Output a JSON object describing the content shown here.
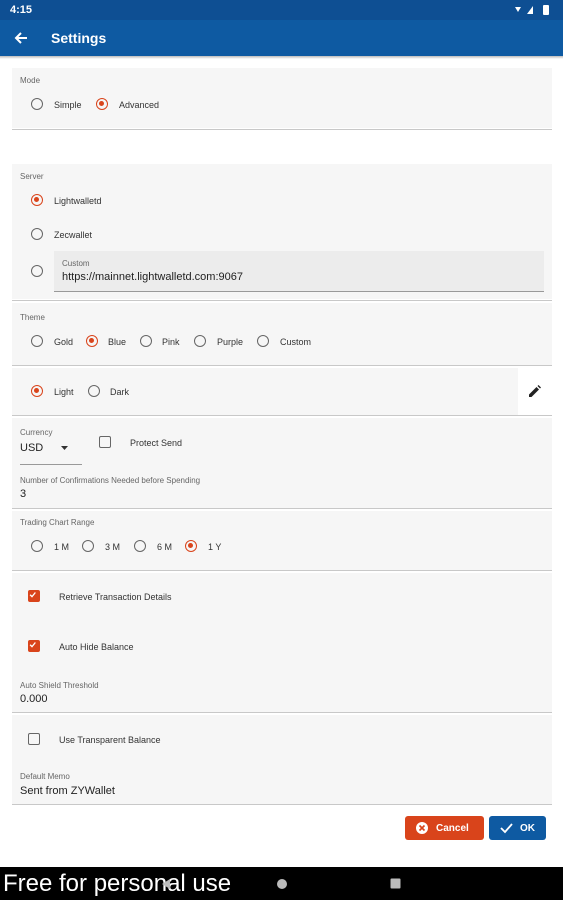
{
  "status_bar": {
    "time": "4:15"
  },
  "app_bar": {
    "title": "Settings"
  },
  "mode": {
    "label": "Mode",
    "options": [
      "Simple",
      "Advanced"
    ],
    "selected": "Advanced"
  },
  "server": {
    "label": "Server",
    "options": [
      "Lightwalletd",
      "Zecwallet"
    ],
    "selected": "Lightwalletd",
    "custom_label": "Custom",
    "custom_value": "https://mainnet.lightwalletd.com:9067"
  },
  "theme": {
    "label": "Theme",
    "options": [
      "Gold",
      "Blue",
      "Pink",
      "Purple",
      "Custom"
    ],
    "selected": "Blue",
    "brightness_options": [
      "Light",
      "Dark"
    ],
    "brightness_selected": "Light"
  },
  "currency": {
    "label": "Currency",
    "value": "USD",
    "protect_send_label": "Protect Send",
    "protect_send_checked": false
  },
  "confirmations": {
    "label": "Number of Confirmations Needed before Spending",
    "value": "3"
  },
  "chart_range": {
    "label": "Trading Chart Range",
    "options": [
      "1 M",
      "3 M",
      "6 M",
      "1 Y"
    ],
    "selected": "1 Y"
  },
  "retrieve_tx": {
    "label": "Retrieve Transaction Details",
    "checked": true
  },
  "auto_hide": {
    "label": "Auto Hide Balance",
    "checked": true
  },
  "auto_shield": {
    "label": "Auto Shield Threshold",
    "value": "0.000"
  },
  "transparent": {
    "label": "Use Transparent Balance",
    "checked": false
  },
  "memo": {
    "label": "Default Memo",
    "value": "Sent from ZYWallet"
  },
  "buttons": {
    "cancel": "Cancel",
    "ok": "OK"
  },
  "watermark": "Free for personal use",
  "colors": {
    "primary": "#0e5aa2",
    "accent": "#d9441b",
    "panel": "#f6f6f6"
  }
}
